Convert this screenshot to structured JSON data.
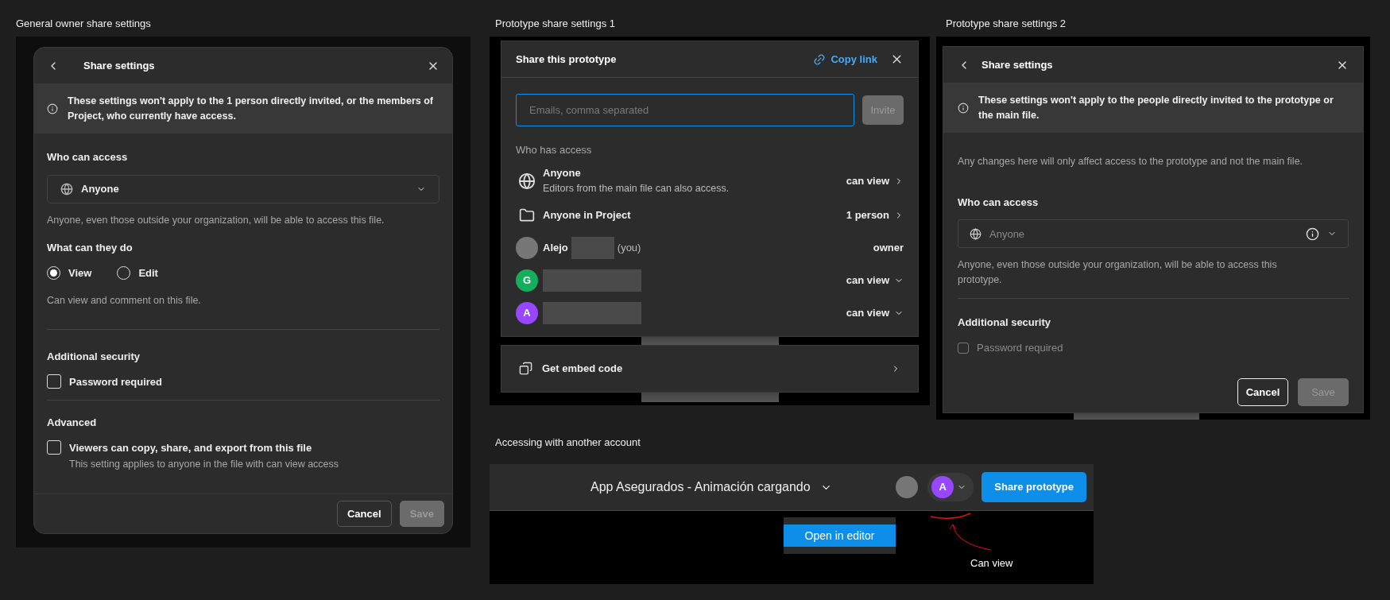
{
  "general_share_settings": {
    "frame_label": "General owner share settings",
    "title": "Share settings",
    "notice": "These settings won't apply to the 1 person directly invited, or the members of Project, who currently have access.",
    "access_label": "Who can access",
    "access_value": "Anyone",
    "access_hint": "Anyone, even those outside your organization, will be able to access this file.",
    "permission_label": "What can they do",
    "permissions": [
      {
        "label": "View",
        "selected": true
      },
      {
        "label": "Edit",
        "selected": false
      }
    ],
    "permission_hint": "Can view and comment on this file.",
    "security_label": "Additional security",
    "password": {
      "label": "Password required",
      "checked": false
    },
    "advanced_label": "Advanced",
    "viewers_option": {
      "label": "Viewers can copy, share, and export from this file",
      "hint": "This setting applies to anyone in the file with can view access",
      "checked": false
    },
    "buttons": [
      {
        "label": "Cancel",
        "disabled": false
      },
      {
        "label": "Save",
        "disabled": true
      }
    ]
  },
  "prototype_share_settings_1": {
    "frame_label": "Prototype share settings 1",
    "title": "Share this prototype",
    "copy_link": "Copy link",
    "email_placeholder": "Emails, comma separated",
    "invite": {
      "label": "Invite",
      "disabled": true
    },
    "access_heading": "Who has access",
    "entries": [
      {
        "kind": "globe",
        "name": "Anyone",
        "detail": "Editors from the main file can also access.",
        "role": "can view"
      },
      {
        "kind": "folder",
        "name": "Anyone in Project",
        "role": "1 person"
      },
      {
        "kind": "photo",
        "name": "Alejo",
        "redacted": true,
        "suffix": "(you)",
        "role": "owner"
      },
      {
        "kind": "initial",
        "initial": "G",
        "color": "#14ae5c",
        "redacted": true,
        "role": "can view"
      },
      {
        "kind": "initial",
        "initial": "A",
        "color": "#9747ff",
        "redacted": true,
        "role": "can view"
      }
    ],
    "embed": "Get embed code"
  },
  "prototype_share_settings_2": {
    "frame_label": "Prototype share settings 2",
    "title": "Share settings",
    "notice": "These settings won't apply to the people directly invited to the prototype or the main file.",
    "scope_hint": "Any changes here will only affect access to the prototype and not the main file.",
    "access_label": "Who can access",
    "access_value": "Anyone",
    "access_disabled": true,
    "access_hint": "Anyone, even those outside your organization, will be able to access this prototype.",
    "security_label": "Additional security",
    "password": {
      "label": "Password required",
      "checked": false,
      "disabled": true
    },
    "buttons": [
      {
        "label": "Cancel",
        "disabled": false
      },
      {
        "label": "Save",
        "disabled": true
      }
    ]
  },
  "accessing_another_account": {
    "frame_label": "Accessing with another account",
    "file_title": "App Asegurados - Animación cargando",
    "avatar_initial": "A",
    "share_button": "Share prototype",
    "menu_item": "Open in editor",
    "annotation": "Can view"
  }
}
